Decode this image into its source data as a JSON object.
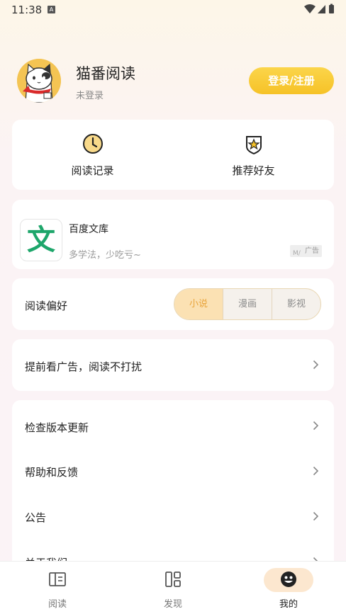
{
  "status_bar": {
    "time": "11:38",
    "notification_badge": "A"
  },
  "profile": {
    "app_name": "猫番阅读",
    "login_status": "未登录",
    "login_button": "登录/注册"
  },
  "quick_actions": [
    {
      "label": "阅读记录",
      "icon": "clock-icon"
    },
    {
      "label": "推荐好友",
      "icon": "star-shield-icon"
    }
  ],
  "ad": {
    "logo_char": "文",
    "title": "百度文库",
    "description": "多学法，少吃亏~",
    "badge": "广告"
  },
  "preference": {
    "label": "阅读偏好",
    "options": [
      "小说",
      "漫画",
      "影视"
    ],
    "selected": "小说"
  },
  "ad_free": {
    "label": "提前看广告，阅读不打扰"
  },
  "settings_list": [
    {
      "label": "检查版本更新"
    },
    {
      "label": "帮助和反馈"
    },
    {
      "label": "公告"
    },
    {
      "label": "关于我们"
    }
  ],
  "bottom_nav": [
    {
      "label": "阅读",
      "icon": "book-icon"
    },
    {
      "label": "发现",
      "icon": "grid-icon"
    },
    {
      "label": "我的",
      "icon": "profile-face-icon",
      "active": true
    }
  ],
  "colors": {
    "accent": "#f6c227",
    "accent_text": "#e9a43a",
    "ad_green": "#1ea66b"
  }
}
